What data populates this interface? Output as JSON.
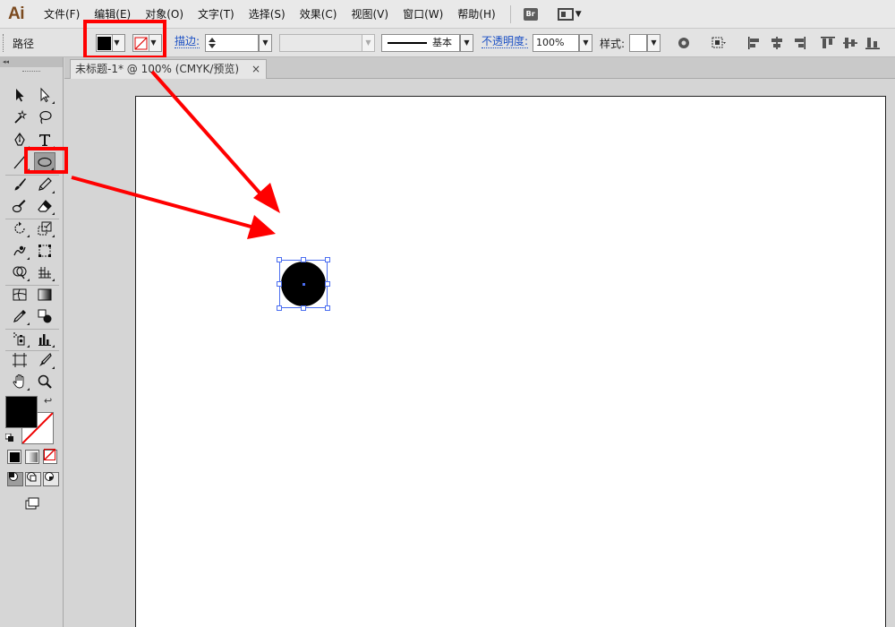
{
  "app": {
    "logo": "Ai"
  },
  "menu": {
    "items": [
      "文件(F)",
      "编辑(E)",
      "对象(O)",
      "文字(T)",
      "选择(S)",
      "效果(C)",
      "视图(V)",
      "窗口(W)",
      "帮助(H)"
    ],
    "bridge_label": "Br"
  },
  "control": {
    "selection_label": "路径",
    "stroke_label": "描边:",
    "brush_label": "基本",
    "opacity_label": "不透明度:",
    "opacity_value": "100%",
    "style_label": "样式:"
  },
  "tab": {
    "title": "未标题-1* @ 100% (CMYK/预览)",
    "close": "×"
  },
  "colors": {
    "fill": "#000000",
    "stroke": "none",
    "annotation": "#ff0000",
    "selection": "#4a6df0"
  },
  "tools": [
    "selection-tool",
    "direct-selection-tool",
    "magic-wand-tool",
    "lasso-tool",
    "pen-tool",
    "type-tool",
    "line-segment-tool",
    "ellipse-tool",
    "paintbrush-tool",
    "pencil-tool",
    "blob-brush-tool",
    "eraser-tool",
    "rotate-tool",
    "scale-tool",
    "warp-tool",
    "free-transform-tool",
    "shape-builder-tool",
    "perspective-grid-tool",
    "mesh-tool",
    "gradient-tool",
    "eyedropper-tool",
    "blend-tool",
    "symbol-sprayer-tool",
    "column-graph-tool",
    "artboard-tool",
    "slice-tool",
    "hand-tool",
    "zoom-tool"
  ],
  "selected_tool": "ellipse-tool"
}
